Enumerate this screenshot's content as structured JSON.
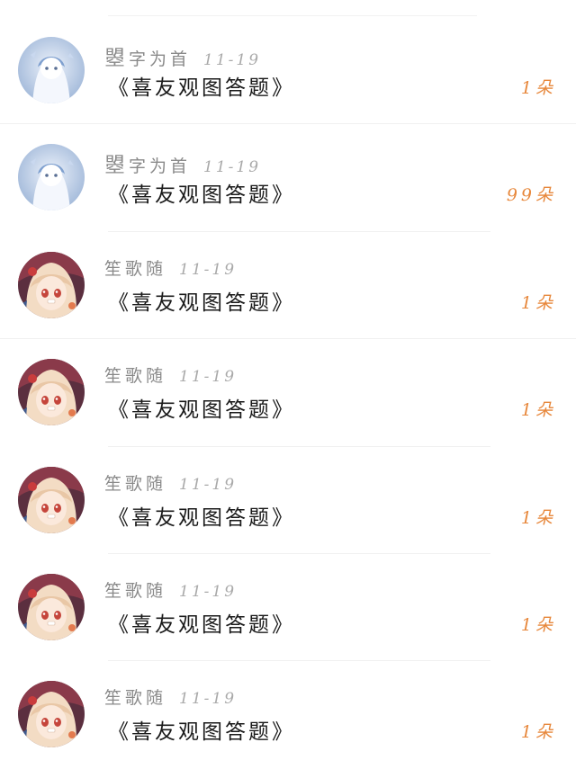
{
  "messages": [
    {
      "username": "曌字为首",
      "date": "11-19",
      "title": "《喜友观图答题》",
      "gift": "1朵",
      "avatar_icon": "blue-ghost-avatar"
    },
    {
      "username": "曌字为首",
      "date": "11-19",
      "title": "《喜友观图答题》",
      "gift": "99朵",
      "avatar_icon": "blue-ghost-avatar"
    },
    {
      "username": "笙歌随",
      "date": "11-19",
      "title": "《喜友观图答题》",
      "gift": "1朵",
      "avatar_icon": "anime-girl-avatar"
    },
    {
      "username": "笙歌随",
      "date": "11-19",
      "title": "《喜友观图答题》",
      "gift": "1朵",
      "avatar_icon": "anime-girl-avatar"
    },
    {
      "username": "笙歌随",
      "date": "11-19",
      "title": "《喜友观图答题》",
      "gift": "1朵",
      "avatar_icon": "anime-girl-avatar"
    },
    {
      "username": "笙歌随",
      "date": "11-19",
      "title": "《喜友观图答题》",
      "gift": "1朵",
      "avatar_icon": "anime-girl-avatar"
    },
    {
      "username": "笙歌随",
      "date": "11-19",
      "title": "《喜友观图答题》",
      "gift": "1朵",
      "avatar_icon": "anime-girl-avatar"
    }
  ],
  "colors": {
    "gift_accent": "#e7873b",
    "username_gray": "#8a8a8a",
    "date_gray": "#a9a9a9",
    "title_dark": "#1a1a1a"
  }
}
